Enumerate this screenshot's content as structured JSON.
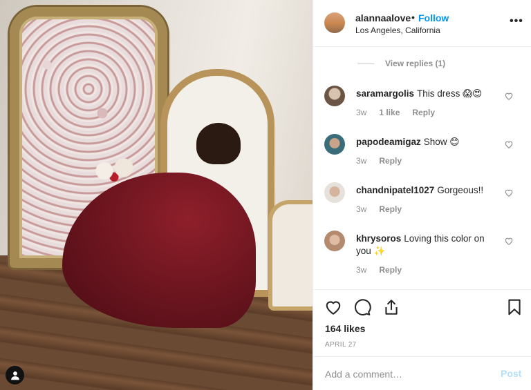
{
  "post": {
    "username": "alannaalove",
    "separator": "•",
    "follow_label": "Follow",
    "location": "Los Angeles, California",
    "more_label": "•••"
  },
  "view_replies": "View replies (1)",
  "comments": [
    {
      "username": "saramargolis",
      "text": "This dress 😱😍",
      "time": "3w",
      "likes": "1 like",
      "reply": "Reply"
    },
    {
      "username": "papodeamigaz",
      "text": "Show 😊",
      "time": "3w",
      "reply": "Reply"
    },
    {
      "username": "chandnipatel1027",
      "text": "Gorgeous!!",
      "time": "3w",
      "reply": "Reply"
    },
    {
      "username": "khrysoros",
      "text": "Loving this color on you ✨",
      "time": "3w",
      "reply": "Reply"
    }
  ],
  "likes": "164 likes",
  "date": "APRIL 27",
  "add_comment": {
    "placeholder": "Add a comment…",
    "post_label": "Post"
  },
  "colors": {
    "link_blue": "#0095f6",
    "post_disabled": "#b2dffc",
    "muted": "#8e8e8e",
    "text": "#262626"
  },
  "icons": [
    "heart-icon",
    "comment-icon",
    "share-icon",
    "bookmark-icon",
    "user-tag-icon",
    "more-options-icon"
  ]
}
